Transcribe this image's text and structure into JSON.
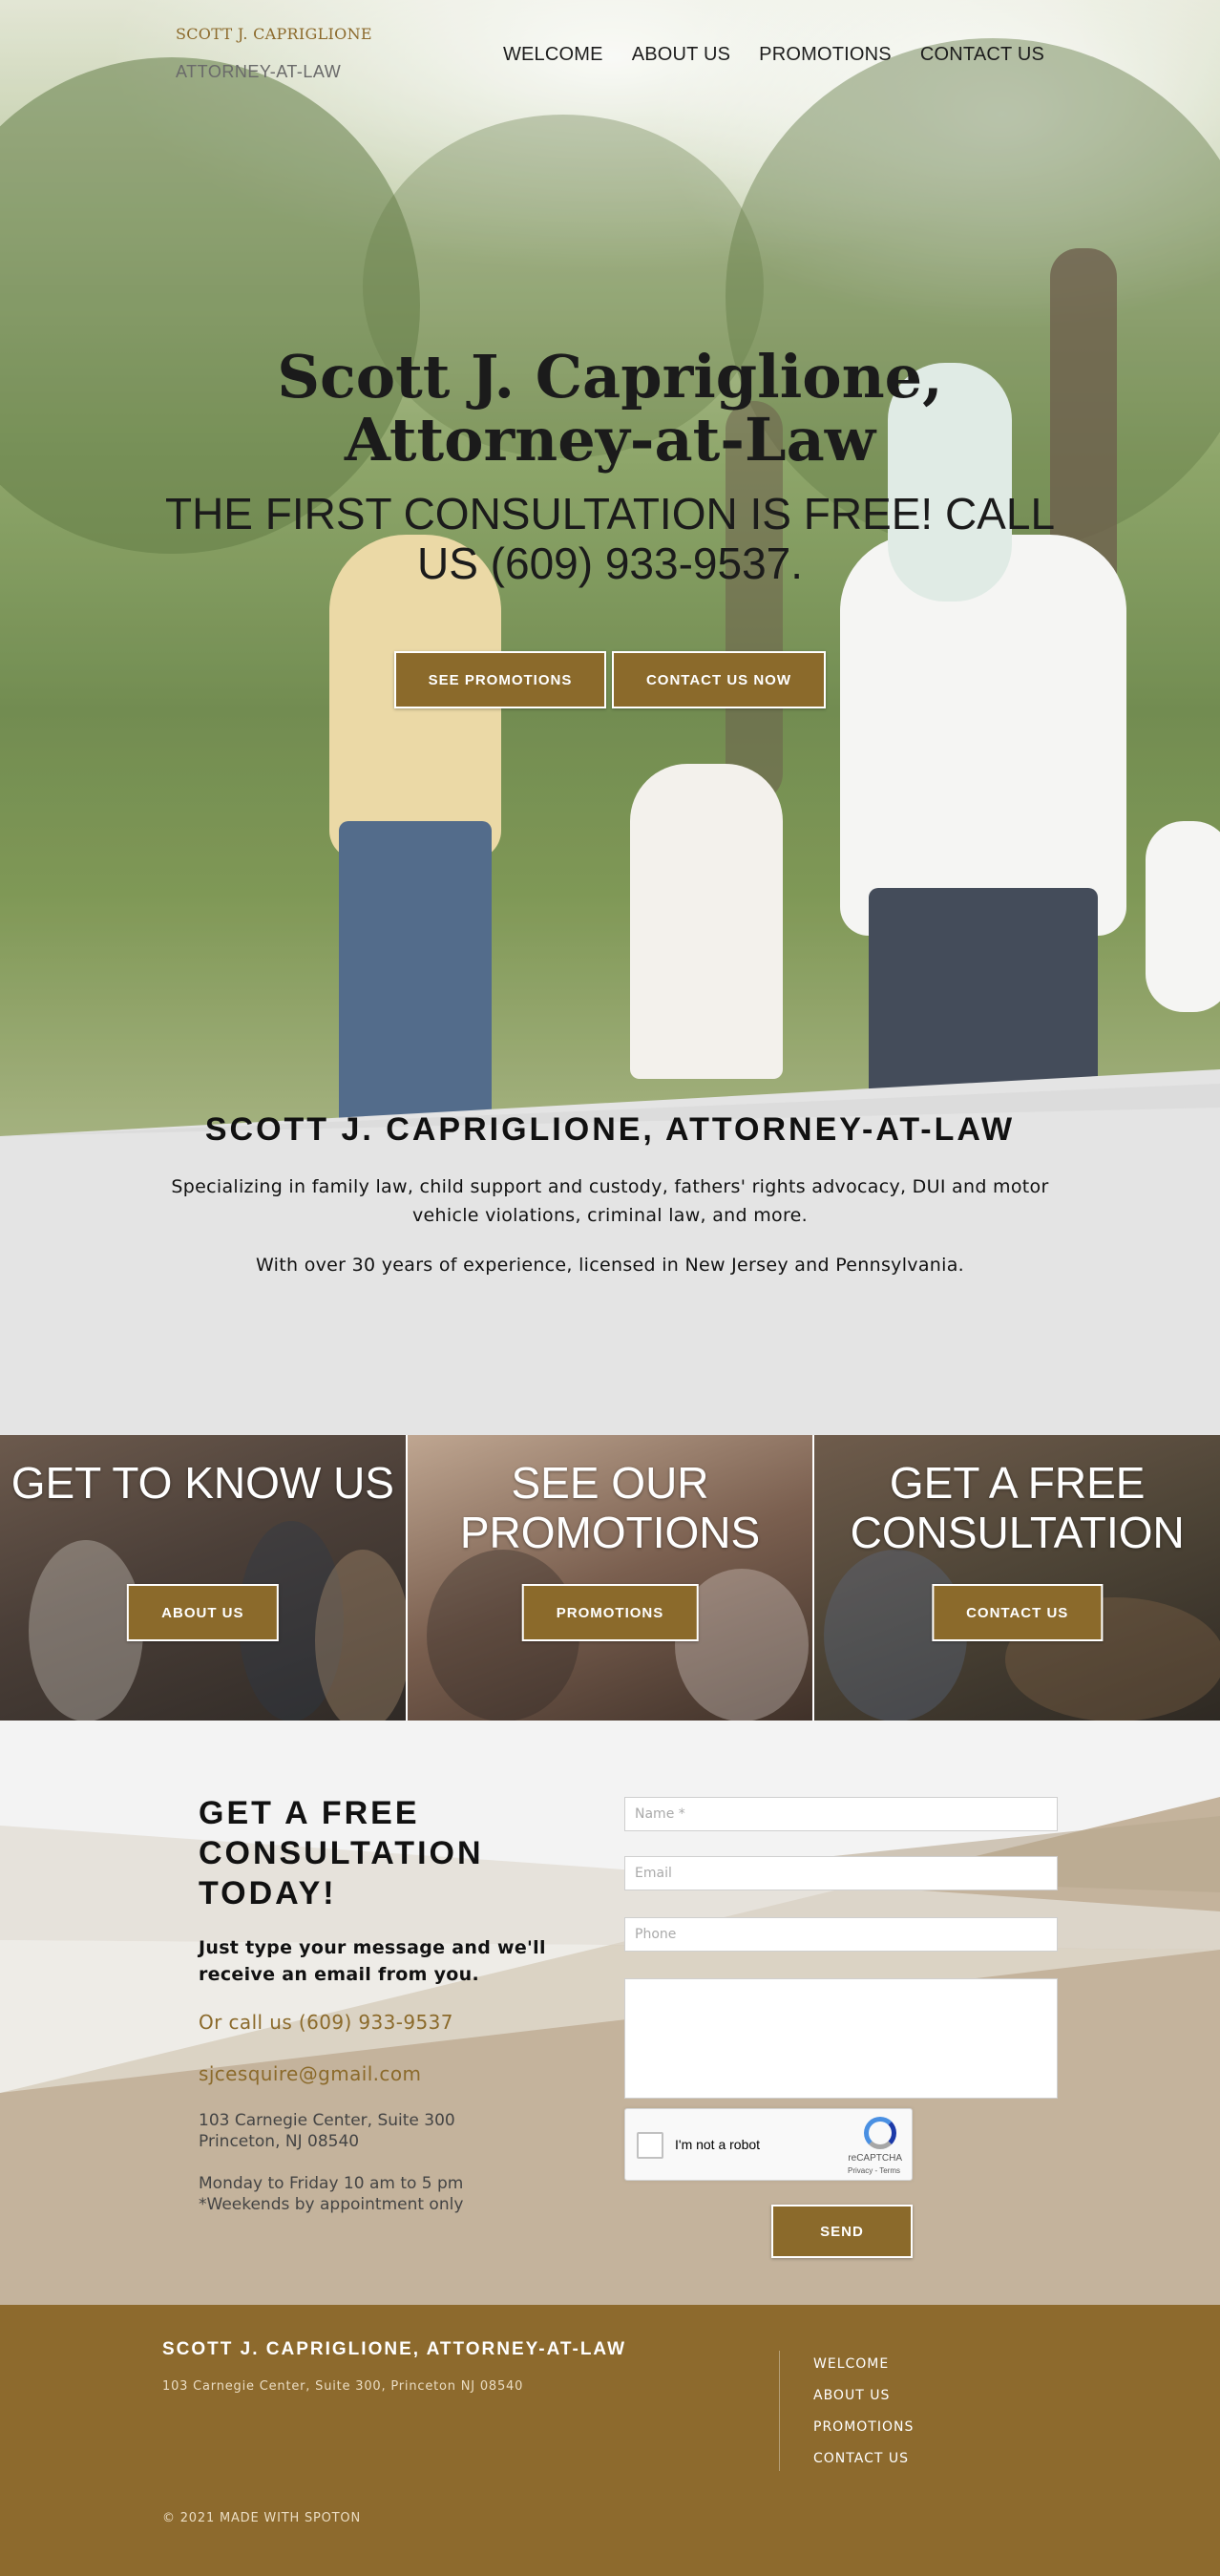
{
  "header": {
    "brand_name": "SCOTT J. CAPRIGLIONE",
    "brand_sub": "ATTORNEY-AT-LAW",
    "nav": [
      {
        "label": "WELCOME"
      },
      {
        "label": "ABOUT US"
      },
      {
        "label": "PROMOTIONS"
      },
      {
        "label": "CONTACT US"
      }
    ]
  },
  "hero": {
    "title_line1": "Scott J. Capriglione,",
    "title_line2": "Attorney-at-Law",
    "subtitle": "THE FIRST CONSULTATION IS FREE! CALL US (609) 933-9537.",
    "btn_promotions": "SEE PROMOTIONS",
    "btn_contact": "CONTACT US NOW"
  },
  "about": {
    "title": "SCOTT J. CAPRIGLIONE, ATTORNEY-AT-LAW",
    "text1": "Specializing in family law, child support and custody, fathers' rights advocacy, DUI and motor vehicle violations, criminal law, and more.",
    "text2": "With over 30 years of experience, licensed in New Jersey and Pennsylvania."
  },
  "tiles": [
    {
      "title": "GET TO KNOW US",
      "button": "ABOUT US"
    },
    {
      "title": "SEE OUR PROMOTIONS",
      "button": "PROMOTIONS"
    },
    {
      "title": "GET A FREE CONSULTATION",
      "button": "CONTACT US"
    }
  ],
  "contact": {
    "title": "GET A FREE CONSULTATION TODAY!",
    "lead": "Just type your message and we'll receive an email from you.",
    "phone": "Or call us (609) 933-9537",
    "email": "sjcesquire@gmail.com",
    "address_line1": "103 Carnegie Center, Suite 300",
    "address_line2": "Princeton, NJ 08540",
    "hours_line1": "Monday to Friday 10 am to 5 pm",
    "hours_line2": "*Weekends by appointment only",
    "form": {
      "name_placeholder": "Name *",
      "email_placeholder": "Email",
      "phone_placeholder": "Phone",
      "message_placeholder": "",
      "recaptcha_label": "I'm not a robot",
      "recaptcha_brand": "reCAPTCHA",
      "recaptcha_terms": "Privacy - Terms",
      "send_label": "SEND"
    }
  },
  "footer": {
    "brand": "SCOTT J. CAPRIGLIONE, ATTORNEY-AT-LAW",
    "address": "103 Carnegie Center, Suite 300, Princeton NJ 08540",
    "links": [
      {
        "label": "WELCOME"
      },
      {
        "label": "ABOUT US"
      },
      {
        "label": "PROMOTIONS"
      },
      {
        "label": "CONTACT US"
      }
    ],
    "copyright": "© 2021 MADE WITH SPOTON"
  },
  "colors": {
    "accent": "#8b6a2b",
    "footer_bg": "#8d6a2d",
    "about_bg": "#e4e4e4",
    "contact_bg": "#c4b39c"
  }
}
